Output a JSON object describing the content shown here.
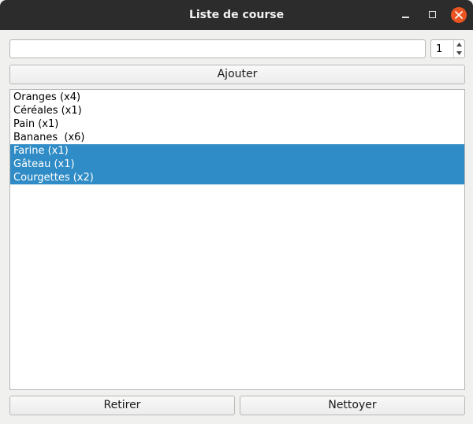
{
  "window": {
    "title": "Liste de course"
  },
  "form": {
    "item_value": "",
    "quantity": "1",
    "add_label": "Ajouter"
  },
  "list": {
    "items": [
      {
        "label": "Oranges (x4)",
        "selected": false
      },
      {
        "label": "Céréales (x1)",
        "selected": false
      },
      {
        "label": "Pain (x1)",
        "selected": false
      },
      {
        "label": "Bananes  (x6)",
        "selected": false
      },
      {
        "label": "Farine (x1)",
        "selected": true
      },
      {
        "label": "Gâteau (x1)",
        "selected": true
      },
      {
        "label": "Courgettes (x2)",
        "selected": true
      }
    ]
  },
  "actions": {
    "remove_label": "Retirer",
    "clear_label": "Nettoyer"
  },
  "colors": {
    "titlebar": "#2c2c2c",
    "close_button": "#e95420",
    "selection": "#308cc6",
    "background": "#f0f0ef"
  }
}
